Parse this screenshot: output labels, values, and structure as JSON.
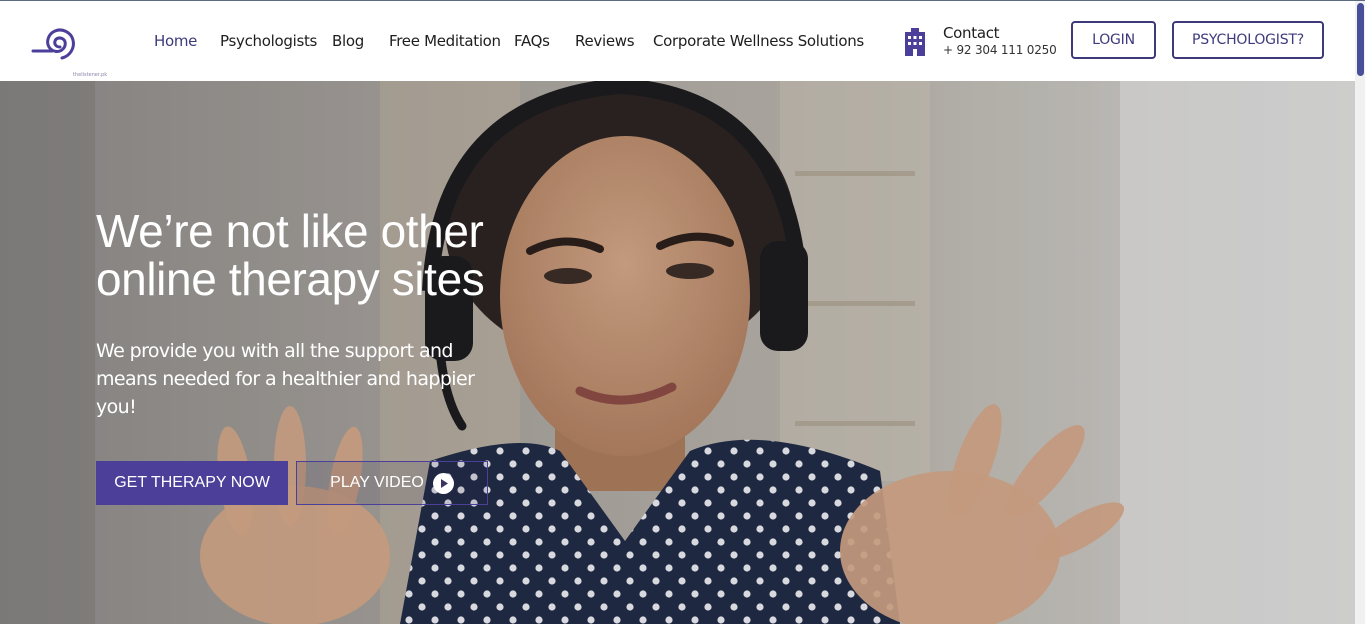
{
  "brand": {
    "logo_text": "thelistener.pk"
  },
  "nav": {
    "items": [
      {
        "label": "Home",
        "active": true
      },
      {
        "label": "Psychologists"
      },
      {
        "label": "Blog"
      },
      {
        "label": "Free Meditation"
      },
      {
        "label": "FAQs"
      },
      {
        "label": "Reviews"
      },
      {
        "label": "Corporate Wellness Solutions"
      }
    ]
  },
  "contact": {
    "label": "Contact",
    "phone": "+ 92 304 111 0250",
    "icon": "building-icon"
  },
  "header_buttons": {
    "login": "LOGIN",
    "psychologist": "PSYCHOLOGIST?"
  },
  "hero": {
    "title_line1": "We’re not like other",
    "title_line2": "online therapy sites",
    "subtitle": "We provide you with all the support and means needed for a healthier and happier you!",
    "cta_primary": "GET THERAPY NOW",
    "cta_secondary": "PLAY VIDEO"
  },
  "colors": {
    "brand": "#3d3a7c",
    "cta": "#4b3f9a",
    "nav_text": "#1e1e1e"
  }
}
